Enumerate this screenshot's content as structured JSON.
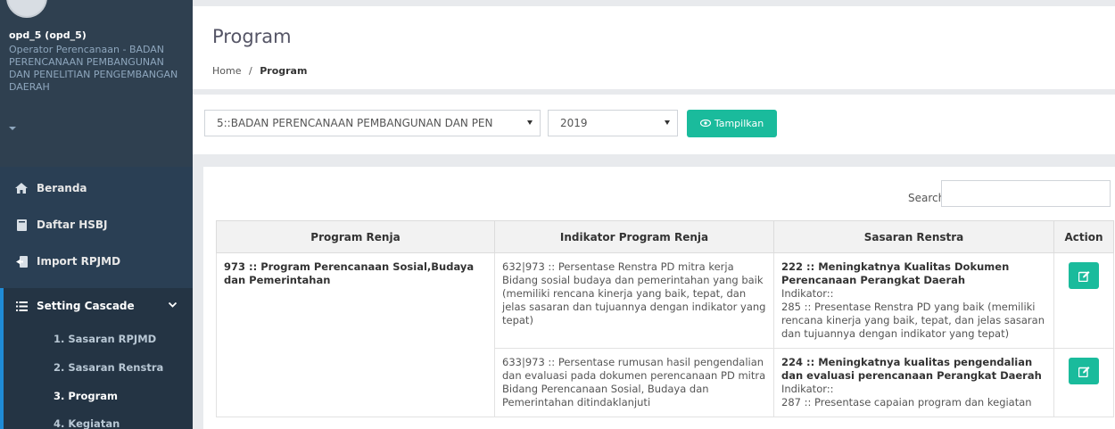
{
  "sidebar": {
    "user_name": "opd_5 (opd_5)",
    "user_role": "Operator Perencanaan - BADAN PERENCANAAN PEMBANGUNAN DAN PENELITIAN PENGEMBANGAN DAERAH",
    "nav": [
      {
        "label": "Beranda",
        "icon": "home-icon"
      },
      {
        "label": "Daftar HSBJ",
        "icon": "book-icon"
      },
      {
        "label": "Import RPJMD",
        "icon": "import-icon"
      },
      {
        "label": "Setting Cascade",
        "icon": "list-icon"
      }
    ],
    "submenu": [
      "1. Sasaran RPJMD",
      "2. Sasaran Renstra",
      "3. Program",
      "4. Kegiatan"
    ]
  },
  "header": {
    "title": "Program",
    "breadcrumb_home": "Home",
    "breadcrumb_sep": "/",
    "breadcrumb_current": "Program"
  },
  "filters": {
    "opd_selected": "5::BADAN PERENCANAAN PEMBANGUNAN DAN PEN",
    "year_selected": "2019",
    "show_button": "Tampilkan"
  },
  "table": {
    "search_label": "Search:",
    "search_value": "",
    "columns": [
      "Program Renja",
      "Indikator Program Renja",
      "Sasaran Renstra",
      "Action"
    ],
    "rows": [
      {
        "program": "973 :: Program Perencanaan Sosial,Budaya dan Pemerintahan",
        "indikator": "632|973 :: Persentase Renstra PD mitra kerja Bidang sosial budaya dan pemerintahan yang baik (memiliki rencana kinerja yang baik, tepat, dan jelas sasaran dan tujuannya dengan indikator yang tepat)",
        "sasaran_title": "222 :: Meningkatnya Kualitas Dokumen Perencanaan Perangkat Daerah",
        "sasaran_ind_label": "Indikator::",
        "sasaran_ind": "285 :: Presentase Renstra PD yang baik (memiliki rencana kinerja yang baik, tepat, dan jelas sasaran dan tujuannya dengan indikator yang tepat)"
      },
      {
        "program": "",
        "indikator": "633|973 :: Persentase rumusan hasil pengendalian dan evaluasi pada dokumen perencanaan PD mitra Bidang Perencanaan Sosial, Budaya dan Pemerintahan ditindaklanjuti",
        "sasaran_title": "224 :: Meningkatnya kualitas pengendalian dan evaluasi perencanaan Perangkat Daerah",
        "sasaran_ind_label": "Indikator::",
        "sasaran_ind": "287 :: Presentase capaian program dan kegiatan"
      }
    ]
  },
  "colors": {
    "sidebar_bg": "#2a3f54",
    "accent": "#1abb9c",
    "active_border": "#1f8bd6"
  }
}
